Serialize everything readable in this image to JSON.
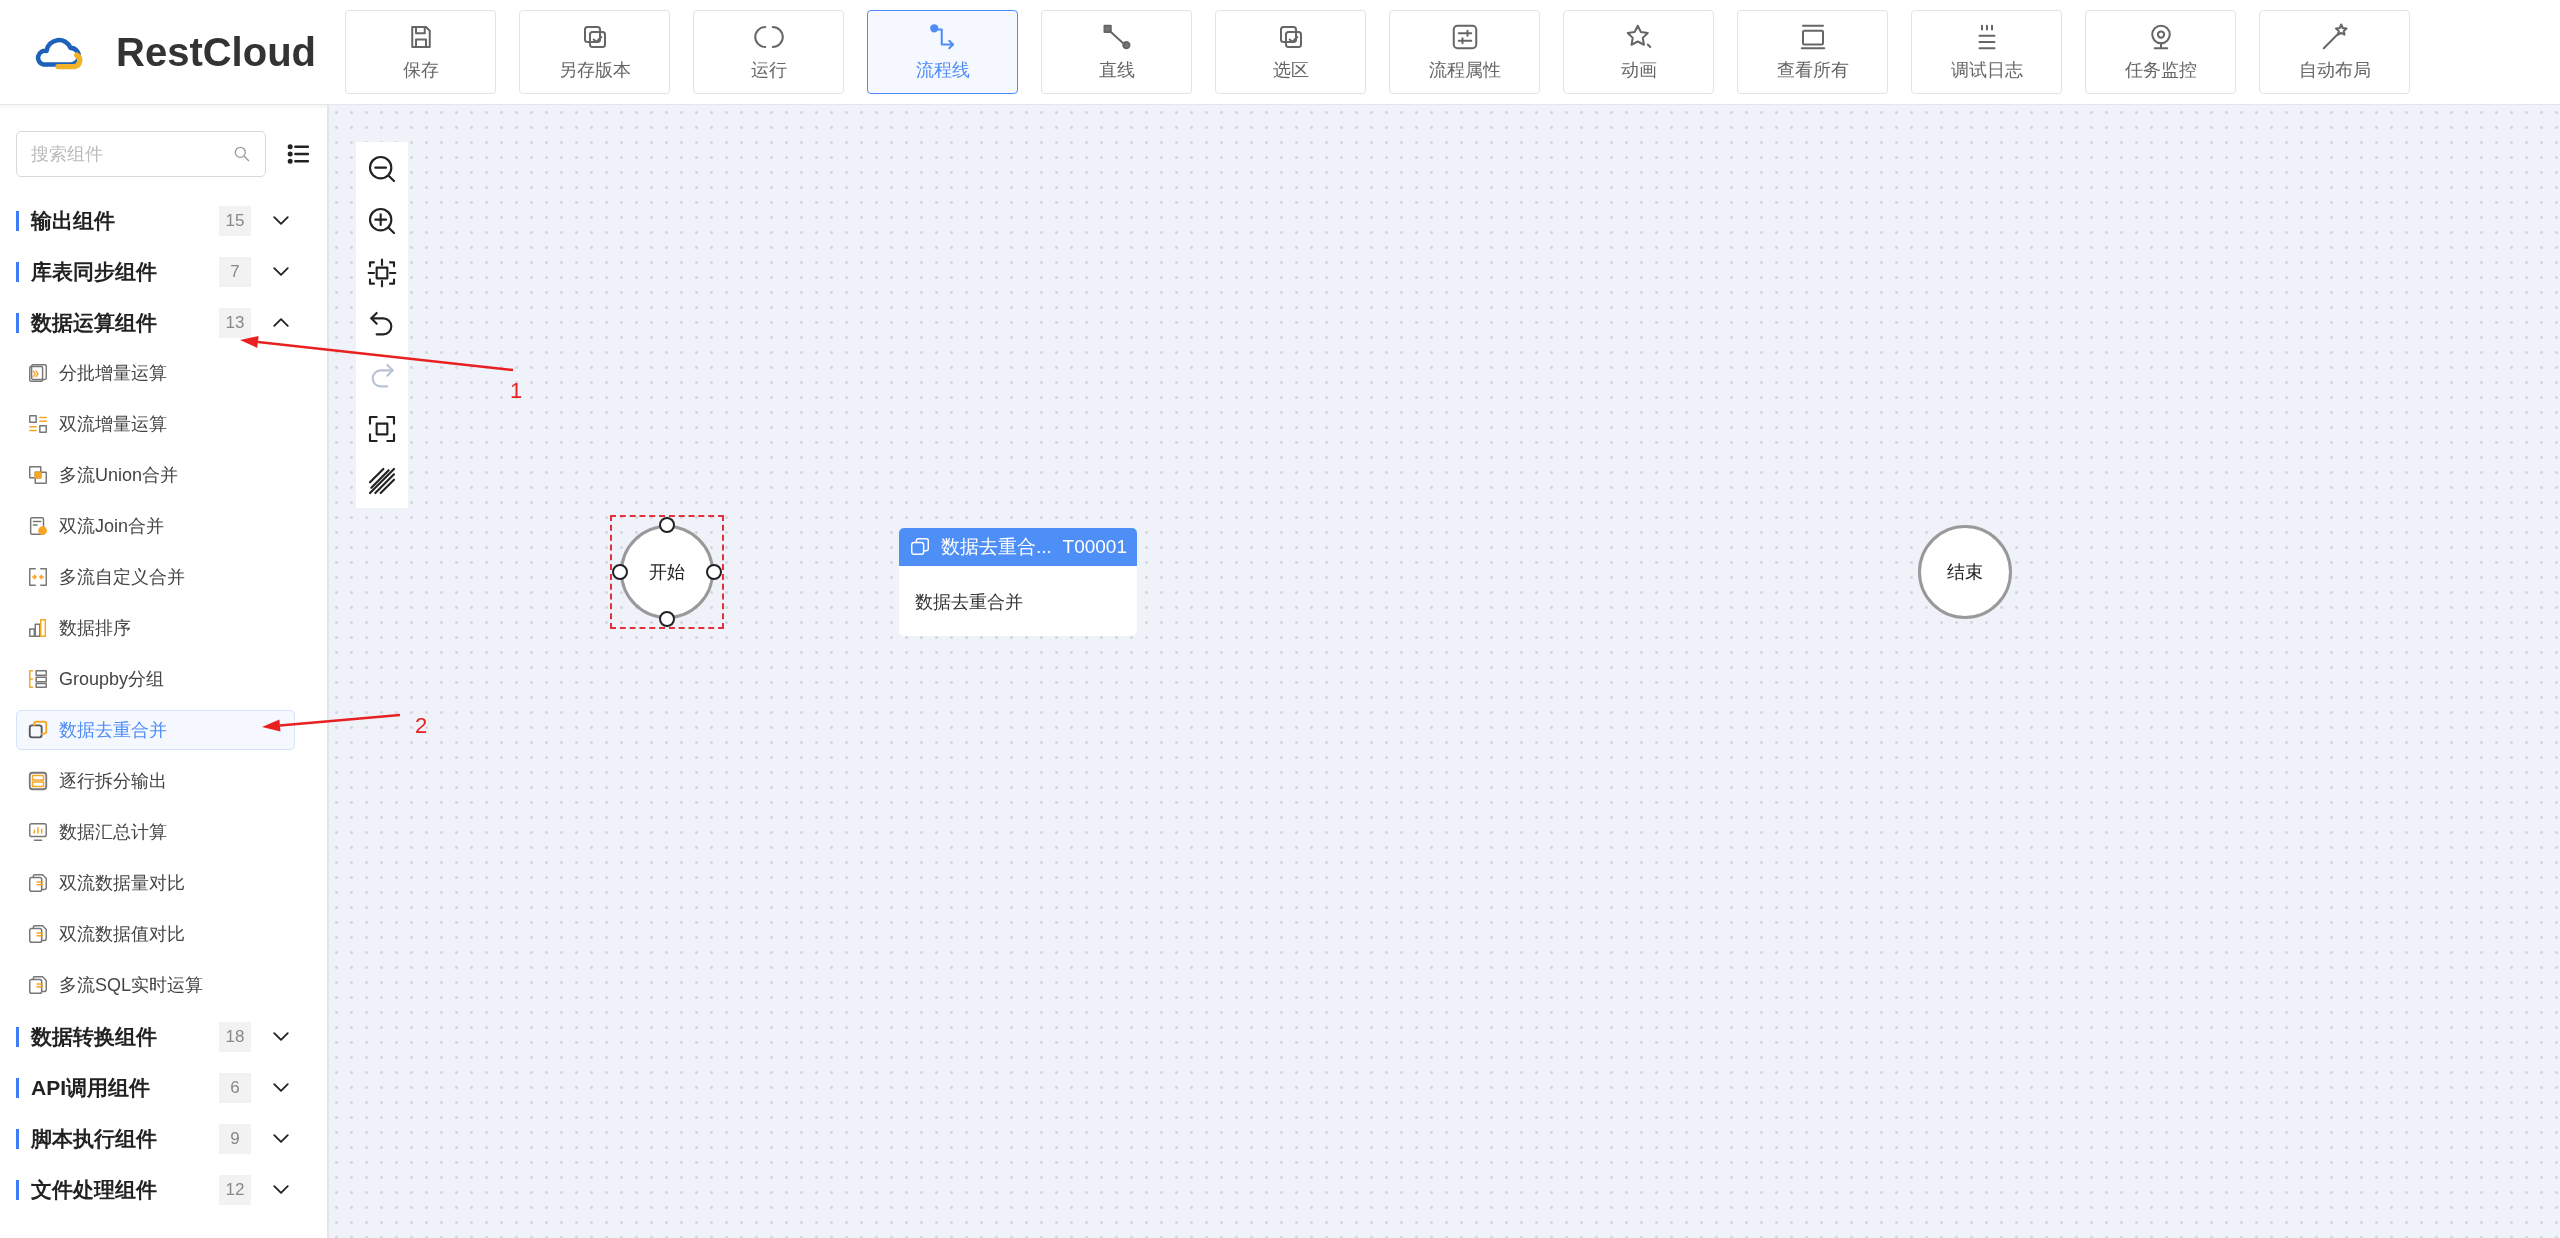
{
  "logo": {
    "text": "RestCloud"
  },
  "toolbar": [
    {
      "label": "保存",
      "selected": false
    },
    {
      "label": "另存版本",
      "selected": false
    },
    {
      "label": "运行",
      "selected": false
    },
    {
      "label": "流程线",
      "selected": true
    },
    {
      "label": "直线",
      "selected": false
    },
    {
      "label": "选区",
      "selected": false
    },
    {
      "label": "流程属性",
      "selected": false
    },
    {
      "label": "动画",
      "selected": false
    },
    {
      "label": "查看所有",
      "selected": false
    },
    {
      "label": "调试日志",
      "selected": false
    },
    {
      "label": "任务监控",
      "selected": false
    },
    {
      "label": "自动布局",
      "selected": false
    }
  ],
  "sidebar": {
    "search": {
      "placeholder": "搜索组件"
    },
    "categories": [
      {
        "name": "输出组件",
        "count": "15",
        "expanded": false
      },
      {
        "name": "库表同步组件",
        "count": "7",
        "expanded": false
      },
      {
        "name": "数据运算组件",
        "count": "13",
        "expanded": true,
        "items": [
          {
            "label": "分批增量运算",
            "selected": false
          },
          {
            "label": "双流增量运算",
            "selected": false
          },
          {
            "label": "多流Union合并",
            "selected": false
          },
          {
            "label": "双流Join合并",
            "selected": false
          },
          {
            "label": "多流自定义合并",
            "selected": false
          },
          {
            "label": "数据排序",
            "selected": false
          },
          {
            "label": "Groupby分组",
            "selected": false
          },
          {
            "label": "数据去重合并",
            "selected": true
          },
          {
            "label": "逐行拆分输出",
            "selected": false
          },
          {
            "label": "数据汇总计算",
            "selected": false
          },
          {
            "label": "双流数据量对比",
            "selected": false
          },
          {
            "label": "双流数据值对比",
            "selected": false
          },
          {
            "label": "多流SQL实时运算",
            "selected": false
          }
        ]
      },
      {
        "name": "数据转换组件",
        "count": "18",
        "expanded": false
      },
      {
        "name": "API调用组件",
        "count": "6",
        "expanded": false
      },
      {
        "name": "脚本执行组件",
        "count": "9",
        "expanded": false
      },
      {
        "name": "文件处理组件",
        "count": "12",
        "expanded": false
      }
    ]
  },
  "canvas_tools": [
    {
      "disabled": false
    },
    {
      "disabled": false
    },
    {
      "disabled": false
    },
    {
      "disabled": false
    },
    {
      "disabled": true
    },
    {
      "disabled": false
    },
    {
      "disabled": false
    }
  ],
  "nodes": [
    {
      "kind": "start",
      "label": "开始",
      "selected": true
    },
    {
      "kind": "task",
      "title": "数据去重合...",
      "code": "T00001",
      "body": "数据去重合并"
    },
    {
      "kind": "end",
      "label": "结束",
      "selected": false
    }
  ],
  "annotations": [
    {
      "label": "1"
    },
    {
      "label": "2"
    }
  ]
}
